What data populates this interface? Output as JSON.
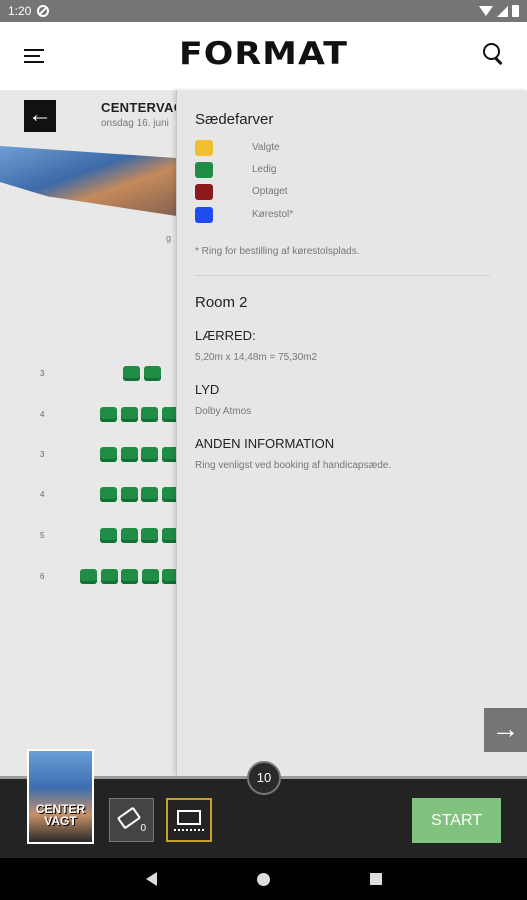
{
  "status_bar": {
    "time": "1:20"
  },
  "app_bar": {
    "logo": "FORMAT"
  },
  "showing": {
    "cinema": "CENTERVAG",
    "date": "onsdag 16. juni",
    "screen_label": "g"
  },
  "seat_rows": [
    {
      "num": "3",
      "seats": 2
    },
    {
      "num": "4",
      "seats": 4
    },
    {
      "num": "3",
      "seats": 4
    },
    {
      "num": "4",
      "seats": 4
    },
    {
      "num": "5",
      "seats": 4
    },
    {
      "num": "6",
      "seats": 5
    }
  ],
  "panel": {
    "title": "Sædefarver",
    "legend": [
      {
        "label": "Valgte",
        "color": "#f0c030"
      },
      {
        "label": "Ledig",
        "color": "#1f8d45"
      },
      {
        "label": "Optaget",
        "color": "#8b1a1a"
      },
      {
        "label": "Kørestol*",
        "color": "#1f4cf0"
      }
    ],
    "note": "* Ring for bestilling af kørestolsplads.",
    "room": "Room 2",
    "sections": [
      {
        "heading": "LÆRRED:",
        "value": "5,20m x 14,48m = 75,30m2"
      },
      {
        "heading": "LYD",
        "value": "Dolby Atmos"
      },
      {
        "heading": "ANDEN INFORMATION",
        "value": "Ring venligst ved booking af handicapsæde."
      }
    ]
  },
  "bottom_bar": {
    "poster_text": "CENTER VAGT",
    "seat_counter": "10",
    "ticket_count": "0",
    "start_label": "START"
  },
  "icons": {
    "back": "←",
    "next": "→"
  }
}
